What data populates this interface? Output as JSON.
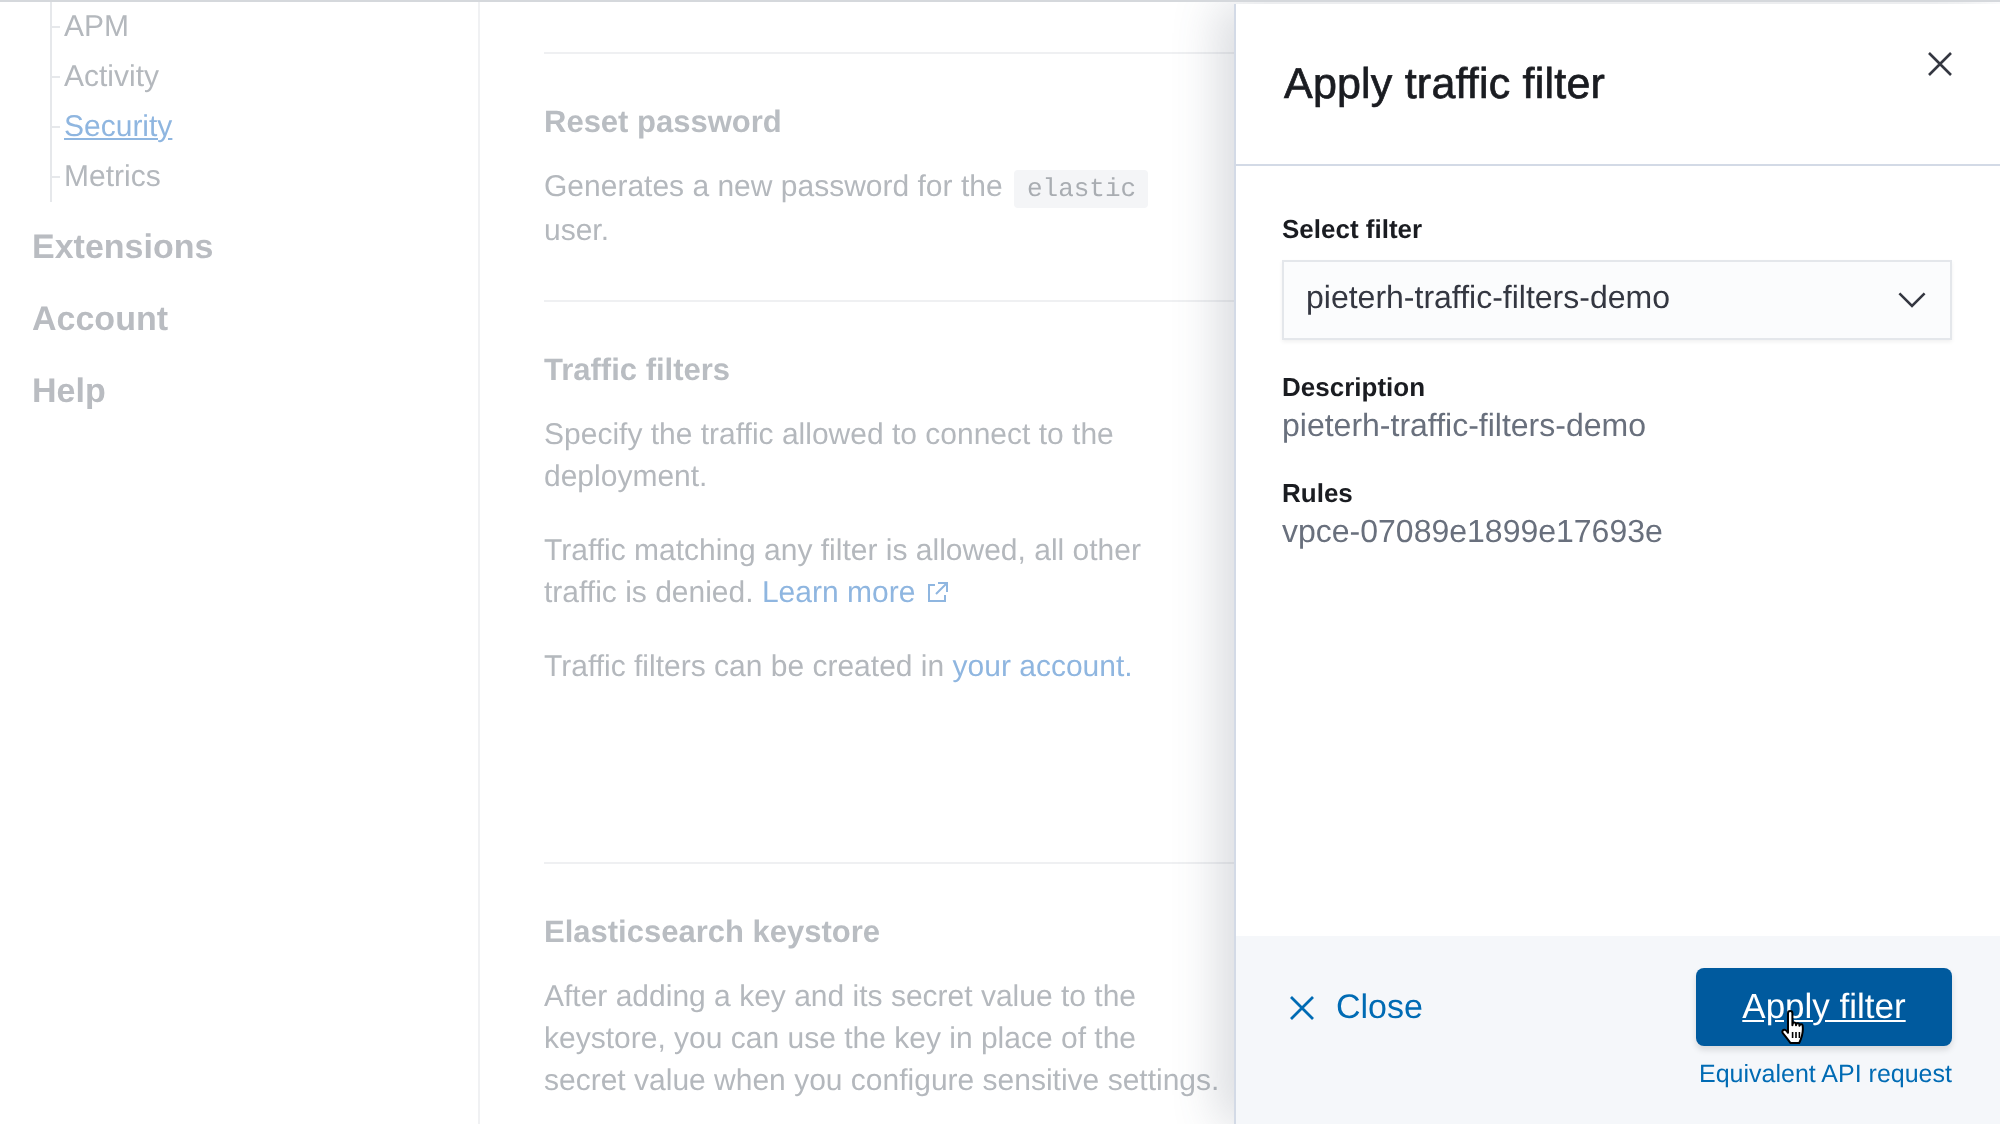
{
  "sidebar": {
    "sub_items": [
      {
        "label": "APM",
        "selected": false
      },
      {
        "label": "Activity",
        "selected": false
      },
      {
        "label": "Security",
        "selected": true
      },
      {
        "label": "Metrics",
        "selected": false
      }
    ],
    "groups": [
      {
        "label": "Extensions"
      },
      {
        "label": "Account"
      },
      {
        "label": "Help"
      }
    ]
  },
  "main": {
    "sections": [
      {
        "title": "Reset password",
        "paragraphs": [
          [
            {
              "kind": "text",
              "text": "Generates a new password for the "
            },
            {
              "kind": "code",
              "text": "elastic"
            },
            {
              "kind": "text",
              "text": " user."
            }
          ]
        ]
      },
      {
        "title": "Traffic filters",
        "paragraphs": [
          [
            {
              "kind": "text",
              "text": "Specify the traffic allowed to connect to the deployment."
            }
          ],
          [
            {
              "kind": "text",
              "text": "Traffic matching any filter is allowed, all other traffic is denied. "
            },
            {
              "kind": "external_link",
              "text": "Learn more"
            }
          ],
          [
            {
              "kind": "text",
              "text": "Traffic filters can be created in "
            },
            {
              "kind": "link",
              "text": "your account."
            }
          ]
        ]
      },
      {
        "title": "Elasticsearch keystore",
        "paragraphs": [
          [
            {
              "kind": "text",
              "text": "After adding a key and its secret value to the keystore, you can use the key in place of the secret value when you configure sensitive settings."
            }
          ]
        ]
      }
    ]
  },
  "flyout": {
    "title": "Apply traffic filter",
    "select": {
      "label": "Select filter",
      "value": "pieterh-traffic-filters-demo"
    },
    "details": [
      {
        "label": "Description",
        "value": "pieterh-traffic-filters-demo"
      },
      {
        "label": "Rules",
        "value": "vpce-07089e1899e17693e"
      }
    ],
    "footer": {
      "close_label": "Close",
      "apply_button": {
        "label": "Apply filter",
        "hovered": true
      },
      "secondary_link": "Equivalent API request"
    }
  }
}
